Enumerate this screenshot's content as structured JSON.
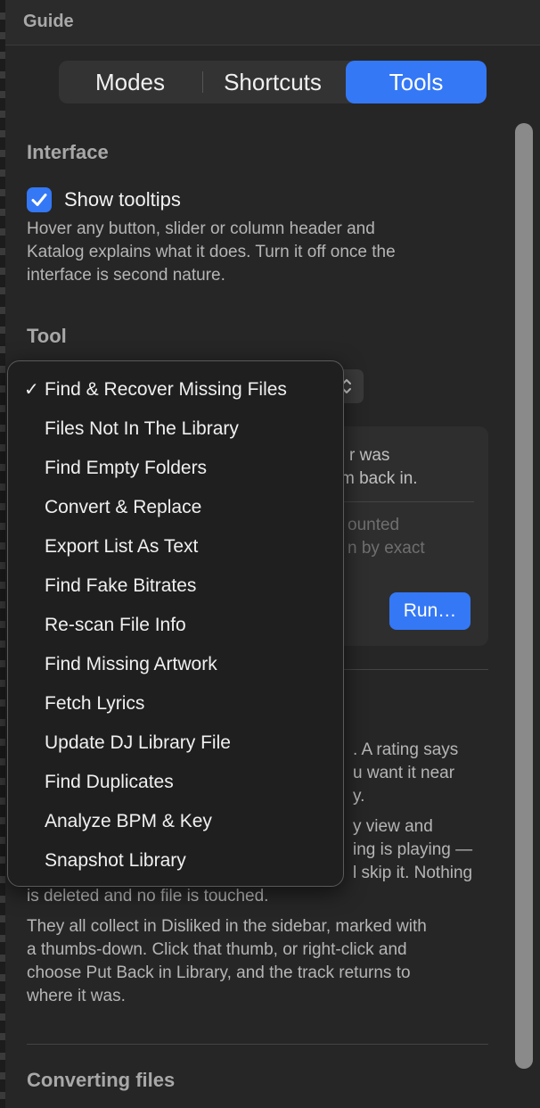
{
  "window": {
    "title": "Guide"
  },
  "tabs": [
    {
      "label": "Modes",
      "selected": false
    },
    {
      "label": "Shortcuts",
      "selected": false
    },
    {
      "label": "Tools",
      "selected": true
    }
  ],
  "interface": {
    "heading": "Interface",
    "tooltips_label": "Show tooltips",
    "tooltips_checked": true,
    "description_lines": [
      "Hover any button, slider or column header and",
      "Katalog explains what it does. Turn it off once the",
      "interface is second nature."
    ]
  },
  "tool": {
    "heading": "Tool",
    "selected": "Find & Recover Missing Files",
    "menu_items": [
      {
        "label": "Find & Recover Missing Files",
        "checked": true
      },
      {
        "label": "Files Not In The Library",
        "checked": false
      },
      {
        "label": "Find Empty Folders",
        "checked": false
      },
      {
        "label": "Convert & Replace",
        "checked": false
      },
      {
        "label": "Export List As Text",
        "checked": false
      },
      {
        "label": "Find Fake Bitrates",
        "checked": false
      },
      {
        "label": "Re-scan File Info",
        "checked": false
      },
      {
        "label": "Find Missing Artwork",
        "checked": false
      },
      {
        "label": "Fetch Lyrics",
        "checked": false
      },
      {
        "label": "Update DJ Library File",
        "checked": false
      },
      {
        "label": "Find Duplicates",
        "checked": false
      },
      {
        "label": "Analyze BPM & Key",
        "checked": false
      },
      {
        "label": "Snapshot Library",
        "checked": false
      }
    ],
    "card": {
      "fragment_1": "r was",
      "fragment_2": "m back in.",
      "fragment_dim_1": "ounted",
      "fragment_dim_2": "n by exact",
      "run_label": "Run…"
    }
  },
  "dislike_fragments": {
    "line_1": ". A rating says",
    "line_2": "u want it near",
    "line_3": "y.",
    "line_4": "y view and",
    "line_5": "ing is playing —",
    "line_6": "l skip it. Nothing",
    "line_7": "is deleted and no file is touched."
  },
  "disliked_paragraph": [
    "They all collect in Disliked in the sidebar, marked with",
    "a thumbs-down. Click that thumb, or right-click and",
    "choose Put Back in Library, and the track returns to",
    "where it was."
  ],
  "converting": {
    "heading": "Converting files"
  },
  "colors": {
    "accent": "#3478f6",
    "background": "#262626",
    "menu_bg": "#1f1f1f"
  },
  "icons": {
    "checkbox": "checkmark-icon",
    "popup": "chevron-up-down-icon",
    "menu_check": "checkmark-icon"
  }
}
